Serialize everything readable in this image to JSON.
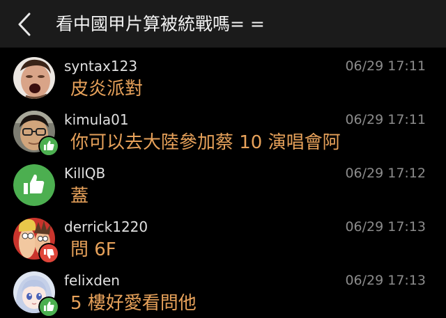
{
  "header": {
    "title": "看中國甲片算被統戰嗎= =",
    "back_icon": "chevron-left-icon"
  },
  "colors": {
    "background": "#000000",
    "header_bg": "#1b1b1b",
    "username": "#e0e0e0",
    "timestamp": "#8c8c8c",
    "comment_text": "#e6a15a",
    "like_green": "#4caf50",
    "dislike_red": "#e0453a"
  },
  "comments": [
    {
      "username": "syntax123",
      "time": "06/29 17:11",
      "text": "皮炎派對",
      "reaction": "none"
    },
    {
      "username": "kimula01",
      "time": "06/29 17:11",
      "text": "你可以去大陸參加蔡 10 演唱會阿",
      "reaction": "like"
    },
    {
      "username": "KillQB",
      "time": "06/29 17:12",
      "text": "蓋",
      "reaction": "like"
    },
    {
      "username": "derrick1220",
      "time": "06/29 17:13",
      "text": "問 6F",
      "reaction": "dislike"
    },
    {
      "username": "felixden",
      "time": "06/29 17:13",
      "text": "5 樓好愛看問他",
      "reaction": "like"
    }
  ]
}
